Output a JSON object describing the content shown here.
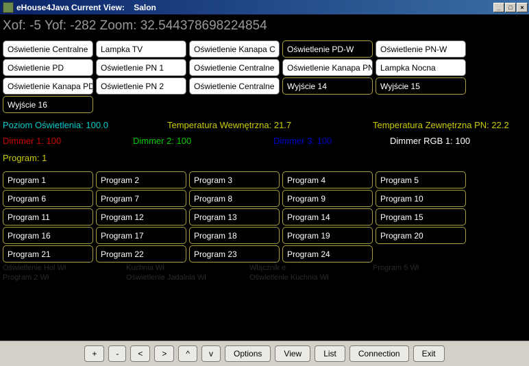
{
  "window": {
    "title": "eHouse4Java Current View:",
    "room": "Salon",
    "btn_min": "_",
    "btn_max": "□",
    "btn_close": "×"
  },
  "coord": {
    "xof_label": "Xof:",
    "xof": "-5",
    "yof_label": "Yof:",
    "yof": "-282",
    "zoom_label": "Zoom:",
    "zoom": "32.544378698224854"
  },
  "lights": [
    [
      {
        "label": "Oświetlenie Centralne",
        "on": true
      },
      {
        "label": "Lampka TV",
        "on": true
      },
      {
        "label": "Oświetlenie Kanapa C",
        "on": true
      },
      {
        "label": "Oświetlenie PD-W",
        "on": false
      },
      {
        "label": "Oświetlenie PN-W",
        "on": true
      }
    ],
    [
      {
        "label": "Oświetlenie PD",
        "on": true
      },
      {
        "label": "Oświetlenie PN 1",
        "on": true
      },
      {
        "label": "Oświetlenie Centralne",
        "on": true
      },
      {
        "label": "Oświetlenie Kanapa PN",
        "on": true
      },
      {
        "label": "Lampka Nocna",
        "on": true
      }
    ],
    [
      {
        "label": "Oświetlenie Kanapa PD",
        "on": true
      },
      {
        "label": "Oświetlenie PN 2",
        "on": true
      },
      {
        "label": "Oświetlenie Centralne",
        "on": true
      },
      {
        "label": "Wyjście 14",
        "on": false
      },
      {
        "label": "Wyjście 15",
        "on": false
      }
    ],
    [
      {
        "label": "Wyjście 16",
        "on": false
      }
    ]
  ],
  "sensors": {
    "light_level_label": "Poziom Oświetlenia:",
    "light_level": "100.0",
    "temp_in_label": "Temperatura Wewnętrzna:",
    "temp_in": "21.7",
    "temp_out_label": "Temperatura Zewnętrzna PN:",
    "temp_out": "22.2"
  },
  "dimmers": {
    "d1_label": "Dimmer 1:",
    "d1": "100",
    "d2_label": "Dimmer 2:",
    "d2": "100",
    "d3_label": "Dimmer 3:",
    "d3": "100",
    "drgb_label": "Dimmer RGB 1:",
    "drgb": "100"
  },
  "program_label": "Program:",
  "program_current": "1",
  "programs": [
    [
      "Program 1",
      "Program 2",
      "Program 3",
      "Program 4",
      "Program 5"
    ],
    [
      "Program 6",
      "Program 7",
      "Program 8",
      "Program 9",
      "Program 10"
    ],
    [
      "Program 11",
      "Program 12",
      "Program 13",
      "Program 14",
      "Program 15"
    ],
    [
      "Program 16",
      "Program 17",
      "Program 18",
      "Program 19",
      "Program 20"
    ],
    [
      "Program 21",
      "Program 22",
      "Program 23",
      "Program 24"
    ]
  ],
  "faint": {
    "r1c1": "Oświetlenie Hol Wł",
    "r1c2": "Kuchnia Wł",
    "r1c3": "Włącznik e",
    "r1c4": "Program 5 Wł",
    "r2c1": "Program 2 Wł",
    "r2c2": "Oświetlenie Jadalnia Wł",
    "r2c3": "Oświetlenie Kuchnia Wł"
  },
  "bottombar": {
    "plus": "+",
    "minus": "-",
    "lt": "<",
    "gt": ">",
    "up": "^",
    "down": "v",
    "options": "Options",
    "view": "View",
    "list": "List",
    "connection": "Connection",
    "exit": "Exit"
  }
}
